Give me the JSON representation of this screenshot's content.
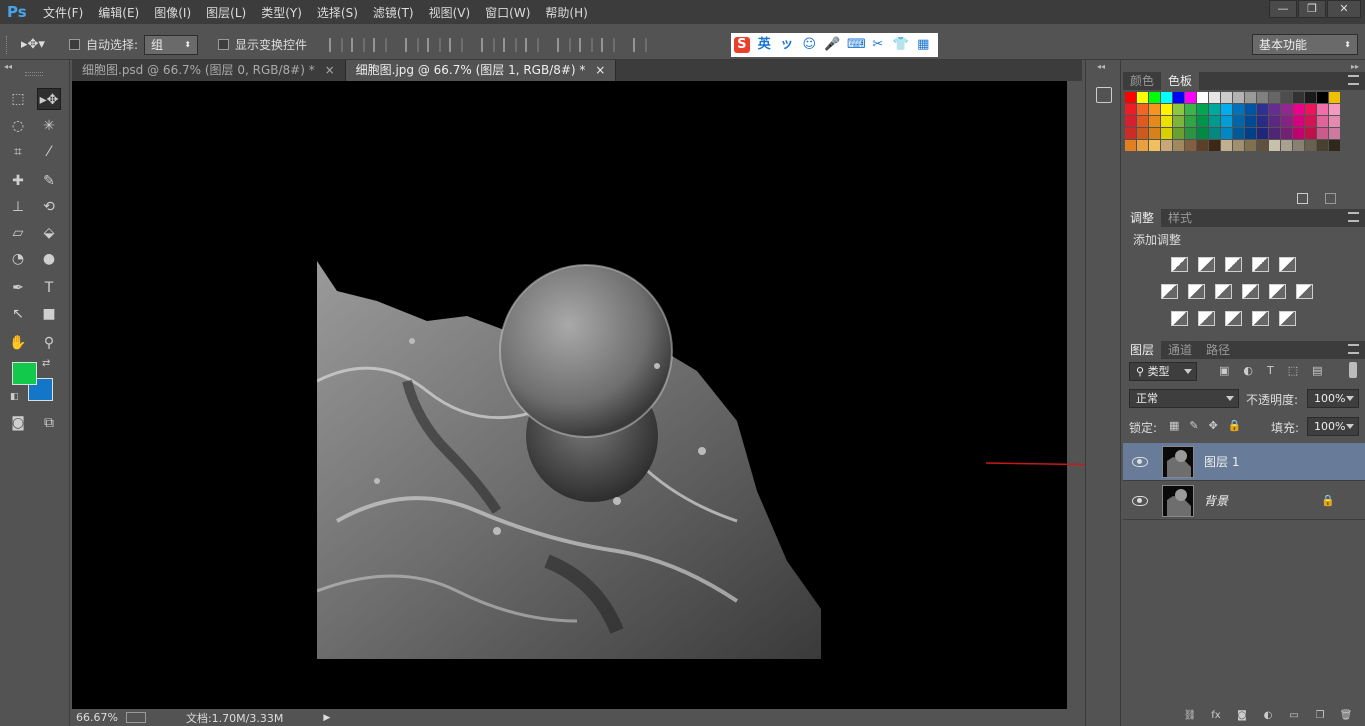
{
  "app": {
    "logo": "Ps"
  },
  "menu": [
    "文件(F)",
    "编辑(E)",
    "图像(I)",
    "图层(L)",
    "类型(Y)",
    "选择(S)",
    "滤镜(T)",
    "视图(V)",
    "窗口(W)",
    "帮助(H)"
  ],
  "window_controls": {
    "minimize": "—",
    "restore": "❐",
    "close": "✕"
  },
  "options": {
    "auto_select_label": "自动选择:",
    "auto_select_value": "组",
    "show_transform_label": "显示变换控件",
    "workspace": "基本功能"
  },
  "ime": {
    "items": [
      "S",
      "英",
      "ッ",
      "☺",
      "🎤",
      "⌨",
      "✂",
      "👕",
      "▦"
    ]
  },
  "doc_tabs": [
    {
      "label": "细胞图.psd @ 66.7% (图层 0, RGB/8#) *",
      "close": "×"
    },
    {
      "label": "细胞图.jpg @ 66.7% (图层 1, RGB/8#) *",
      "close": "×"
    }
  ],
  "status": {
    "zoom": "66.67%",
    "doc_info": "文档:1.70M/3.33M"
  },
  "colors": {
    "foreground": "#12c94c",
    "background": "#1476c7",
    "selected_layer": "#687b99",
    "arrow": "#c41a1a"
  },
  "panels": {
    "color_tabs": [
      "颜色",
      "色板"
    ],
    "adjust_tabs": [
      "调整",
      "样式"
    ],
    "adjust_title": "添加调整",
    "layer_tabs": [
      "图层",
      "通道",
      "路径"
    ],
    "filter_kind": "类型",
    "blend_mode": "正常",
    "opacity_label": "不透明度:",
    "opacity_value": "100%",
    "lock_label": "锁定:",
    "fill_label": "填充:",
    "fill_value": "100%"
  },
  "layers": [
    {
      "name": "图层 1",
      "selected": true,
      "visible": true
    },
    {
      "name": "背景",
      "selected": false,
      "visible": true,
      "locked": true
    }
  ],
  "swatches": [
    "#ff0000",
    "#ffff00",
    "#00ff00",
    "#00ffff",
    "#0000ff",
    "#ff00ff",
    "#ffffff",
    "#e6e6e6",
    "#cccccc",
    "#b3b3b3",
    "#999999",
    "#808080",
    "#666666",
    "#4d4d4d",
    "#333333",
    "#1a1a1a",
    "#000000",
    "#f0c000",
    "#ee1c24",
    "#f26522",
    "#f7941d",
    "#fff200",
    "#8dc63f",
    "#39b54a",
    "#00a651",
    "#00a99d",
    "#00aeef",
    "#0072bc",
    "#0054a6",
    "#2e3192",
    "#662d91",
    "#92278f",
    "#ec008c",
    "#ed145b",
    "#f06eaa",
    "#f49ac1",
    "#d62030",
    "#e05a20",
    "#e58a18",
    "#ebe000",
    "#7fb43a",
    "#31a443",
    "#00954a",
    "#009b8f",
    "#009dd9",
    "#0066aa",
    "#004a95",
    "#282c84",
    "#5c2882",
    "#842383",
    "#d6007e",
    "#d51253",
    "#e0649a",
    "#e48ab0",
    "#cc2c24",
    "#cc5a1c",
    "#d8801a",
    "#d8d000",
    "#6aa030",
    "#2c9440",
    "#008a44",
    "#008a80",
    "#0088c4",
    "#005a98",
    "#004088",
    "#22267a",
    "#502576",
    "#751f75",
    "#c20072",
    "#c0104a",
    "#cc5a8a",
    "#cc7aa0",
    "#e08020",
    "#e8a040",
    "#f0c060",
    "#c8a878",
    "#a08860",
    "#806040",
    "#5a4028",
    "#3c2814",
    "#c0b090",
    "#a09070",
    "#807050",
    "#605040",
    "#c8c0a8",
    "#a8a090",
    "#888070",
    "#686050",
    "#484030",
    "#302818"
  ]
}
